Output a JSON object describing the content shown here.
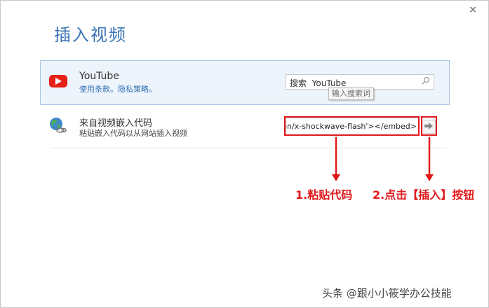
{
  "dialog": {
    "title": "插入视频",
    "close_glyph": "×"
  },
  "youtube": {
    "name": "YouTube",
    "links": [
      "使用条款",
      "隐私策略"
    ],
    "search_value": "搜索  YouTube",
    "tooltip": "输入搜索词"
  },
  "embed": {
    "title": "来自视频嵌入代码",
    "description": "粘贴嵌入代码以从网站插入视频",
    "input_value": "tion/x-shockwave-flash'></embed>"
  },
  "annotations": {
    "step1": "1.粘贴代码",
    "step2": "2.点击【插入】按钮"
  },
  "watermark": "头条 @跟小小筱学办公技能",
  "colors": {
    "title": "#3a74b6",
    "link": "#2f6fb5",
    "annotation_red": "#e0191b",
    "youtube_red": "#e62117",
    "row_highlight": "#eef4fb"
  }
}
